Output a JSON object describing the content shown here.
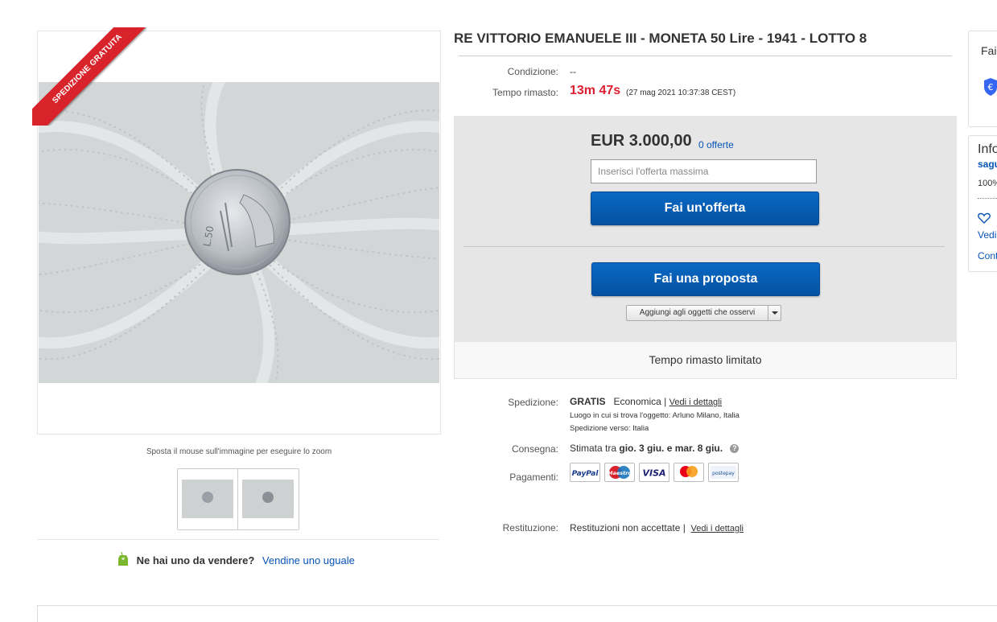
{
  "gallery": {
    "ribbon_text": "SPEDIZIONE GRATUITA",
    "zoom_hint": "Sposta il mouse sull'immagine per eseguire lo zoom",
    "sell_question": "Ne hai uno da vendere?",
    "sell_link": "Vendine uno uguale"
  },
  "listing": {
    "title": "RE VITTORIO EMANUELE III - MONETA 50 Lire - 1941 - LOTTO 8",
    "condition_label": "Condizione:",
    "condition_value": "--",
    "time_label": "Tempo rimasto:",
    "time_left": "13m 47s",
    "time_end": "(27 mag 2021   10:37:38 CEST)"
  },
  "bid": {
    "price": "EUR 3.000,00",
    "bids_link": "0 offerte",
    "input_placeholder": "Inserisci l'offerta massima",
    "bid_button": "Fai un'offerta",
    "offer_button": "Fai una proposta",
    "watch_label": "Aggiungi agli oggetti che osservi",
    "limited_time": "Tempo rimasto limitato"
  },
  "shipping": {
    "label": "Spedizione:",
    "free": "GRATIS",
    "method": "Economica |",
    "details_link": "Vedi i dettagli",
    "location": "Luogo in cui si trova l'oggetto:  Arluno Milano, Italia",
    "ships_to": "Spedizione verso:  Italia"
  },
  "delivery": {
    "label": "Consegna:",
    "prefix": "Stimata tra",
    "range": "gio. 3 giu. e mar. 8 giu.",
    "help_icon": "?"
  },
  "payments": {
    "label": "Pagamenti:",
    "methods": [
      "PayPal",
      "Maestro",
      "VISA",
      "MasterCard",
      "postepay"
    ],
    "icons": [
      "paypal-icon",
      "maestro-icon",
      "visa-icon",
      "mastercard-icon",
      "postepay-icon"
    ]
  },
  "returns": {
    "label": "Restituzione:",
    "value": "Restituzioni non accettate |",
    "details_link": "Vedi i dettagli"
  },
  "right_panel": {
    "top_text": "Fai",
    "info_title": "Info",
    "seller_name": "sagu",
    "seller_feedback": "100%",
    "vedi_link": "Vedi",
    "contact_link": "Cont"
  },
  "colors": {
    "accent_blue": "#0654ba",
    "button_blue": "#0a68c4",
    "time_red": "#dd1e31",
    "ribbon_red": "#d8232a"
  }
}
